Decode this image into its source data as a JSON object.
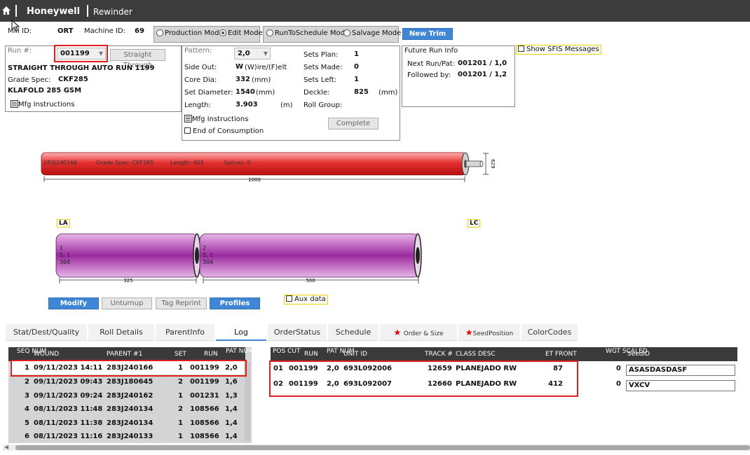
{
  "header": {
    "brand": "Honeywell",
    "module": "Rewinder"
  },
  "machine": {
    "mill_id_label": "Mill ID:",
    "mill_id_value": "ORT",
    "machine_id_label": "Machine ID:",
    "machine_id_value": "69"
  },
  "modes": {
    "production": "Production Mode",
    "edit": "Edit Mode",
    "run_to_schedule": "RunToSchedule Mode",
    "salvage": "Salvage Mode",
    "new_trim": "New Trim"
  },
  "run": {
    "run_label": "Run #:",
    "run_value": "001199",
    "straight_through": "Straight Through",
    "title": "STRAIGHT THROUGH AUTO RUN 1199",
    "grade_spec_label": "Grade Spec:",
    "grade_spec_value": "CKF285",
    "grade_name": "KLAFOLD 285 GSM",
    "mfg_instructions": "Mfg Instructions"
  },
  "pattern": {
    "pattern_label": "Pattern:",
    "pattern_value": "2,0",
    "side_out_label": "Side Out:",
    "side_out_value": "W",
    "side_out_unit": "(W)ire/(F)elt",
    "core_dia_label": "Core Dia:",
    "core_dia_value": "332",
    "core_dia_unit": "(mm)",
    "set_diameter_label": "Set Diameter:",
    "set_diameter_value": "1540",
    "set_diameter_unit": "(mm)",
    "length_label": "Length:",
    "length_value": "3.903",
    "length_unit": "(m)",
    "mfg_instructions": "Mfg Instructions",
    "end_of_consumption": "End of Consumption",
    "sets_plan_label": "Sets Plan:",
    "sets_plan_value": "1",
    "sets_made_label": "Sets Made:",
    "sets_made_value": "0",
    "sets_left_label": "Sets Left:",
    "sets_left_value": "1",
    "deckle_label": "Deckle:",
    "deckle_value": "825",
    "deckle_unit": "(mm)",
    "roll_group_label": "Roll Group:",
    "complete": "Complete"
  },
  "future_run": {
    "title": "Future Run Info",
    "next_label": "Next Run/Pat:",
    "next_value": "001201 / 1,0",
    "followed_label": "Followed by:",
    "followed_value": "001201 / 1,2",
    "show_sfis": "Show SFIS Messages"
  },
  "parent_roll": {
    "id": "283J240166",
    "grade": "Grade Spec: CKF285",
    "length": "Length: 605",
    "splices": "Splices:  0",
    "width_dim": "1000",
    "dia_dim": "629",
    "color_start": "#ffb3b3",
    "color_mid": "#e53030",
    "color_end": "#b81010"
  },
  "sets": {
    "la_tag": "LA",
    "lc_tag": "LC",
    "rolls": [
      {
        "line1": "1",
        "line2": "S, 1",
        "line3": "304",
        "width": "325"
      },
      {
        "line1": "2",
        "line2": "S, 1",
        "line3": "304",
        "width": "500"
      }
    ],
    "color_light": "#e7b6e8",
    "color_main": "#9b2a9e"
  },
  "actions": {
    "modify": "Modify",
    "unturnup": "Unturnup",
    "tag_reprint": "Tag Reprint",
    "profiles": "Profiles",
    "aux_data": "Aux data"
  },
  "tabs": [
    "Stat/Dest/Quality",
    "Roll Details",
    "ParentInfo",
    "Log",
    "OrderStatus",
    "Schedule",
    "Order  &  Size",
    "SeedPosition",
    "ColorCodes"
  ],
  "left_grid": {
    "headers": {
      "seq": "SEQ NUM",
      "wound": "WOUND",
      "parent": "PARENT #1",
      "set": "SET",
      "run": "RUN",
      "pat": "PAT NUM"
    },
    "rows": [
      {
        "seq": "1",
        "wound": "09/11/2023 14:11",
        "parent": "283J240166",
        "set": "1",
        "run": "001199",
        "pat": "2,0"
      },
      {
        "seq": "2",
        "wound": "09/11/2023 09:43",
        "parent": "283J180645",
        "set": "2",
        "run": "001199",
        "pat": "1,6"
      },
      {
        "seq": "3",
        "wound": "09/11/2023 09:24",
        "parent": "283J240162",
        "set": "1",
        "run": "001231",
        "pat": "1,3"
      },
      {
        "seq": "4",
        "wound": "08/11/2023 11:48",
        "parent": "283J240134",
        "set": "2",
        "run": "108566",
        "pat": "1,4"
      },
      {
        "seq": "5",
        "wound": "08/11/2023 11:38",
        "parent": "283J240134",
        "set": "1",
        "run": "108566",
        "pat": "1,4"
      },
      {
        "seq": "6",
        "wound": "08/11/2023 11:16",
        "parent": "283J240133",
        "set": "1",
        "run": "108566",
        "pat": "1,4"
      }
    ]
  },
  "right_grid": {
    "headers": {
      "pos": "POS CUT",
      "run": "RUN",
      "pat": "PAT NUM",
      "unit": "UNIT ID",
      "track": "TRACK #",
      "class": "CLASS DESC",
      "et": "ET FRONT",
      "wgt": "WGT SCALED",
      "seed": "SeedID"
    },
    "rows": [
      {
        "pos": "01",
        "run": "001199",
        "pat": "2,0",
        "unit": "693L092006",
        "track": "12659",
        "class": "PLANEJADO RW",
        "et": "87",
        "wgt": "0",
        "seed": "ASASDASDASF"
      },
      {
        "pos": "02",
        "run": "001199",
        "pat": "2,0",
        "unit": "693L092007",
        "track": "12660",
        "class": "PLANEJADO RW",
        "et": "412",
        "wgt": "0",
        "seed": "VXCV"
      }
    ]
  }
}
